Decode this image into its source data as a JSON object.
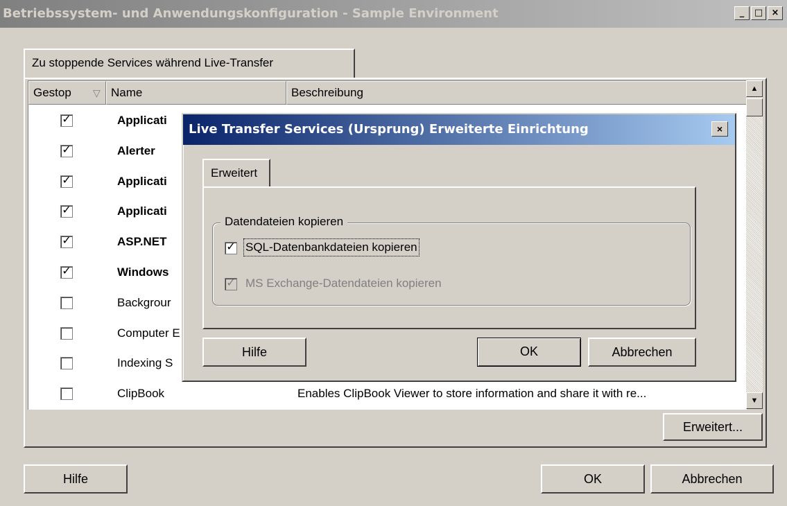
{
  "window": {
    "title": "Betriebssystem- und Anwendungskonfiguration - Sample Environment",
    "controls": [
      "_",
      "□",
      "×"
    ]
  },
  "tab": {
    "label": "Zu stoppende Services während Live-Transfer"
  },
  "table": {
    "columns": [
      "Gestop",
      "Name",
      "Beschreibung"
    ],
    "sort_indicator": "▽",
    "rows": [
      {
        "checked": true,
        "name": "Applicati",
        "description": "",
        "bold": true
      },
      {
        "checked": true,
        "name": "Alerter",
        "description": "",
        "bold": true
      },
      {
        "checked": true,
        "name": "Applicati",
        "description": "",
        "bold": true
      },
      {
        "checked": true,
        "name": "Applicati",
        "description": "",
        "bold": true
      },
      {
        "checked": true,
        "name": "ASP.NET",
        "description": "",
        "bold": true
      },
      {
        "checked": true,
        "name": "Windows",
        "description": "",
        "bold": true
      },
      {
        "checked": false,
        "name": "Backgrour",
        "description": "",
        "bold": false
      },
      {
        "checked": false,
        "name": "Computer E",
        "description": "",
        "bold": false
      },
      {
        "checked": false,
        "name": "Indexing S",
        "description": "",
        "bold": false
      },
      {
        "checked": false,
        "name": "ClipBook",
        "description": "Enables ClipBook Viewer to store information and share it with re...",
        "bold": false
      }
    ]
  },
  "panel_buttons": {
    "advanced": "Erweitert..."
  },
  "footer": {
    "help": "Hilfe",
    "ok": "OK",
    "cancel": "Abbrechen"
  },
  "dialog": {
    "title": "Live Transfer Services (Ursprung) Erweiterte Einrichtung",
    "close": "×",
    "tab": "Erweitert",
    "group_label": "Datendateien kopieren",
    "options": [
      {
        "label": "SQL-Datenbankdateien kopieren",
        "checked": true,
        "enabled": true
      },
      {
        "label": "MS Exchange-Datendateien kopieren",
        "checked": true,
        "enabled": false
      }
    ],
    "buttons": {
      "help": "Hilfe",
      "ok": "OK",
      "cancel": "Abbrechen"
    }
  }
}
